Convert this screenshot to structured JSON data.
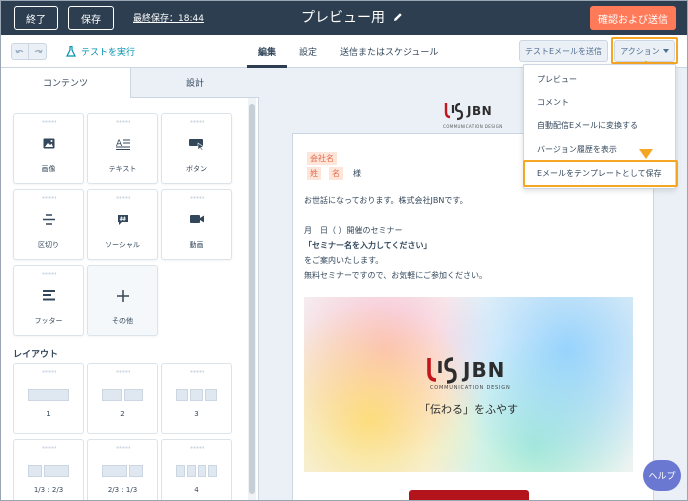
{
  "topbar": {
    "exit_label": "終了",
    "save_label": "保存",
    "last_saved": "最終保存：18:44",
    "title": "プレビュー用",
    "confirm_send_label": "確認および送信"
  },
  "toolbar": {
    "test_run_label": "テストを実行",
    "tabs": [
      {
        "label": "編集",
        "active": true
      },
      {
        "label": "設定",
        "active": false
      },
      {
        "label": "送信またはスケジュール",
        "active": false
      }
    ],
    "test_email_label": "テストEメールを送信",
    "actions_label": "アクション"
  },
  "actions_menu": {
    "items": [
      {
        "label": "プレビュー"
      },
      {
        "label": "コメント"
      },
      {
        "label": "自動配信Eメールに変換する"
      },
      {
        "label": "バージョン履歴を表示"
      },
      {
        "label": "Eメールをテンプレートとして保存",
        "highlighted": true
      }
    ]
  },
  "left_panel": {
    "tabs": [
      {
        "label": "コンテンツ",
        "active": true
      },
      {
        "label": "設計",
        "active": false
      }
    ],
    "modules": [
      {
        "label": "画像",
        "icon": "image-icon"
      },
      {
        "label": "テキスト",
        "icon": "text-icon"
      },
      {
        "label": "ボタン",
        "icon": "button-cursor-icon"
      },
      {
        "label": "区切り",
        "icon": "divider-icon"
      },
      {
        "label": "ソーシャル",
        "icon": "social-hashtag-icon"
      },
      {
        "label": "動画",
        "icon": "video-icon"
      },
      {
        "label": "フッター",
        "icon": "footer-icon"
      },
      {
        "label": "その他",
        "icon": "plus-icon"
      }
    ],
    "layout_heading": "レイアウト",
    "layouts": [
      {
        "label": "1"
      },
      {
        "label": "2"
      },
      {
        "label": "3"
      },
      {
        "label": "1/3 : 2/3"
      },
      {
        "label": "2/3 : 1/3"
      },
      {
        "label": "4"
      }
    ]
  },
  "email": {
    "logo_text": "JBN",
    "logo_sub": "COMMUNICATION DESIGN",
    "merge_company": "会社名",
    "merge_last": "姓",
    "merge_first": "名",
    "honorific": "様",
    "greeting": "お世話になっております。株式会社JBNです。",
    "seminar_date": "月　日（ ）開催のセミナー",
    "seminar_name": "「セミナー名を入力してください」",
    "line_guide": "をご案内いたします。",
    "line_free": "無料セミナーですので、お気軽にご参加ください。",
    "hero_logo": "JBN",
    "hero_sub": "COMMUNICATION DESIGN",
    "hero_tagline": "「伝わる」をふやす"
  },
  "help_label": "ヘルプ",
  "colors": {
    "topbar": "#2d3e50",
    "accent_orange": "#ff7a59",
    "highlight": "#f5a623",
    "link": "#0091ae",
    "help": "#6a78d1",
    "logo_red": "#c4161c"
  }
}
